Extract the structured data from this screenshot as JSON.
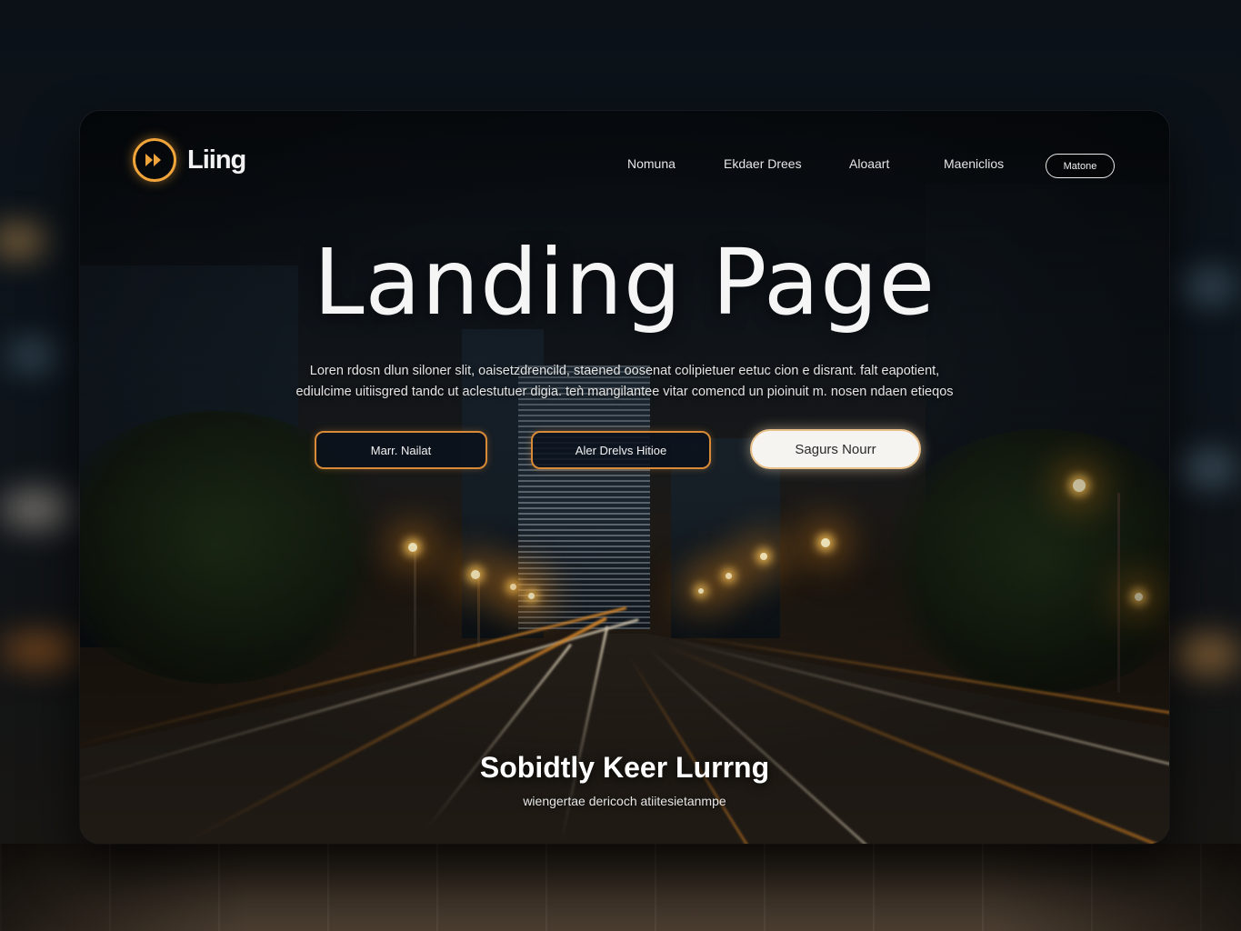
{
  "brand": {
    "name": "Liing",
    "accent": "#f0a43a",
    "logo_icon": "double-chevron-icon"
  },
  "nav": {
    "links": [
      "Nomuna",
      "Ekdaer Drees",
      "Aloaart",
      "Maeniclios"
    ],
    "cta_label": "Matone"
  },
  "hero": {
    "title": "Landing Page",
    "subtitle_line1": "Loren rdosn dlun siloner slit, oaisetzdrencild, staened oosenat colipietuer eetuc cion e disrant. falt eapotient,",
    "subtitle_line2": "ediulcime uitiisgred tandc ut aclestutuer digia. teǹ mangilantee vitar comencd un pioinuit m. nosen ndaen etieqos"
  },
  "buttons": {
    "primary_outline_label": "Marr. Nailat",
    "secondary_outline_label": "Aler Drelvs Hitioe",
    "solid_label": "Sagurs Nourr"
  },
  "footer_hero": {
    "title": "Sobidtly Keer Lurrng",
    "subtitle": "wiengertae dericoch atiitesietanmpe"
  },
  "colors": {
    "button_border": "#d98a36",
    "solid_button_bg": "#f6f4f0",
    "background": "#0d141b"
  }
}
